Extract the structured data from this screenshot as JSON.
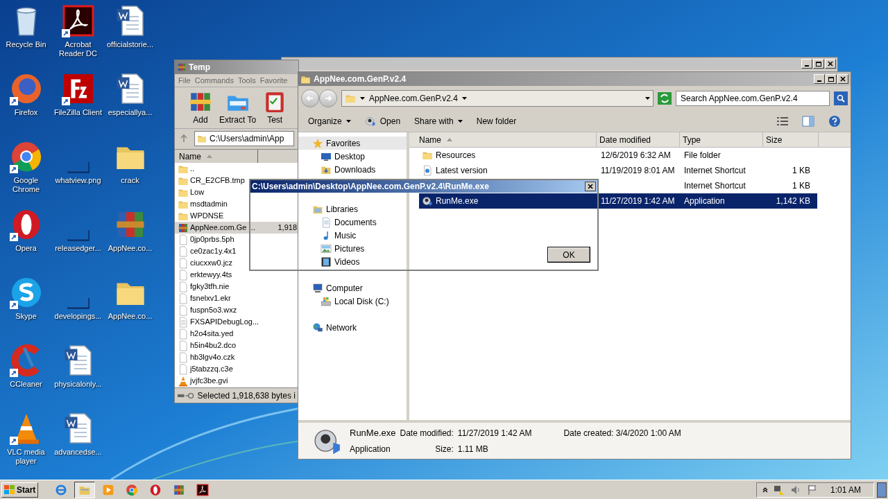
{
  "desktop_icons": [
    {
      "label": "Recycle Bin",
      "kind": "recycle",
      "shortcut": false
    },
    {
      "label": "Firefox",
      "kind": "firefox",
      "shortcut": true
    },
    {
      "label": "Google Chrome",
      "kind": "chrome",
      "shortcut": true
    },
    {
      "label": "Opera",
      "kind": "opera",
      "shortcut": true
    },
    {
      "label": "Skype",
      "kind": "skype",
      "shortcut": true
    },
    {
      "label": "CCleaner",
      "kind": "ccleaner",
      "shortcut": true
    },
    {
      "label": "VLC media player",
      "kind": "vlc",
      "shortcut": true
    },
    {
      "label": "Acrobat Reader DC",
      "kind": "acrobat",
      "shortcut": true
    },
    {
      "label": "FileZilla Client",
      "kind": "filezilla",
      "shortcut": true
    },
    {
      "label": "whatview.png",
      "kind": "blank",
      "shortcut": false
    },
    {
      "label": "releasedger...",
      "kind": "blank",
      "shortcut": false
    },
    {
      "label": "developings...",
      "kind": "blank",
      "shortcut": false
    },
    {
      "label": "physicalonly...",
      "kind": "word",
      "shortcut": false
    },
    {
      "label": "advancedse...",
      "kind": "word",
      "shortcut": false
    },
    {
      "label": "officialstorie...",
      "kind": "word",
      "shortcut": false
    },
    {
      "label": "especiallya...",
      "kind": "word",
      "shortcut": false
    },
    {
      "label": "crack",
      "kind": "folder",
      "shortcut": false
    },
    {
      "label": "AppNee.co...",
      "kind": "archive",
      "shortcut": false
    },
    {
      "label": "AppNee.co...",
      "kind": "folder",
      "shortcut": false
    }
  ],
  "winrar": {
    "title": "Temp",
    "menu": [
      "File",
      "Commands",
      "Tools",
      "Favorite"
    ],
    "tools": [
      {
        "label": "Add",
        "kind": "add"
      },
      {
        "label": "Extract To",
        "kind": "extract"
      },
      {
        "label": "Test",
        "kind": "test"
      }
    ],
    "path": "C:\\Users\\admin\\App",
    "columns": [
      "Name"
    ],
    "files": [
      {
        "name": "..",
        "kind": "folder",
        "selected": false
      },
      {
        "name": "CR_E2CFB.tmp",
        "kind": "folder",
        "selected": false
      },
      {
        "name": "Low",
        "kind": "folder",
        "selected": false
      },
      {
        "name": "msdtadmin",
        "kind": "folder",
        "selected": false
      },
      {
        "name": "WPDNSE",
        "kind": "folder",
        "selected": false
      },
      {
        "name": "AppNee.com.Ge …",
        "kind": "archive",
        "selected": true,
        "size": "1,918"
      },
      {
        "name": "0jp0prbs.5ph",
        "kind": "file",
        "selected": false
      },
      {
        "name": "ce0zac1y.4x1",
        "kind": "file",
        "selected": false
      },
      {
        "name": "ciucxxw0.jcz",
        "kind": "file",
        "selected": false
      },
      {
        "name": "erktewyy.4ts",
        "kind": "file",
        "selected": false
      },
      {
        "name": "fgky3tfh.nie",
        "kind": "file",
        "selected": false
      },
      {
        "name": "fsnelxv1.ekr",
        "kind": "file",
        "selected": false
      },
      {
        "name": "fuspn5o3.wxz",
        "kind": "file",
        "selected": false
      },
      {
        "name": "FXSAPIDebugLog...",
        "kind": "log",
        "selected": false
      },
      {
        "name": "h2o4sita.yed",
        "kind": "file",
        "selected": false
      },
      {
        "name": "h5in4bu2.dco",
        "kind": "file",
        "selected": false
      },
      {
        "name": "hb3lgv4o.czk",
        "kind": "file",
        "selected": false
      },
      {
        "name": "j5tabzzq.c3e",
        "kind": "file",
        "selected": false
      },
      {
        "name": "jvjfc3be.gvi",
        "kind": "vlc",
        "selected": false
      }
    ],
    "status": "Selected 1,918,638 bytes i"
  },
  "explorer": {
    "title": "AppNee.com.GenP.v2.4",
    "address": "AppNee.com.GenP.v2.4",
    "search": {
      "placeholder": "Search AppNee.com.GenP.v2.4"
    },
    "commands": [
      {
        "label": "Organize",
        "menu": true
      },
      {
        "label": "Open",
        "menu": false
      },
      {
        "label": "Share with",
        "menu": true
      },
      {
        "label": "New folder",
        "menu": false
      }
    ],
    "nav": [
      {
        "label": "Favorites",
        "kind": "star",
        "selected": true,
        "children": [
          {
            "label": "Desktop",
            "kind": "desktop",
            "selected": false
          },
          {
            "label": "Downloads",
            "kind": "downloads",
            "selected": false
          }
        ]
      },
      {
        "label": "Libraries",
        "kind": "libraries",
        "selected": false,
        "children": [
          {
            "label": "Documents",
            "kind": "documents",
            "selected": false
          },
          {
            "label": "Music",
            "kind": "music",
            "selected": false
          },
          {
            "label": "Pictures",
            "kind": "pictures",
            "selected": false
          },
          {
            "label": "Videos",
            "kind": "videos",
            "selected": false
          }
        ]
      },
      {
        "label": "Computer",
        "kind": "computer",
        "selected": false,
        "children": [
          {
            "label": "Local Disk (C:)",
            "kind": "disk",
            "selected": false
          }
        ]
      },
      {
        "label": "Network",
        "kind": "network",
        "selected": false
      }
    ],
    "columns": [
      "Name",
      "Date modified",
      "Type",
      "Size"
    ],
    "rows": [
      {
        "name": "Resources",
        "kind": "folder",
        "date": "12/6/2019 6:32 AM",
        "type": "File folder",
        "size": "",
        "selected": false
      },
      {
        "name": "Latest version",
        "kind": "link",
        "date": "11/19/2019 8:01 AM",
        "type": "Internet Shortcut",
        "size": "1 KB",
        "selected": false
      },
      {
        "type": "Internet Shortcut",
        "size": "1 KB",
        "selected": false
      },
      {
        "name": "RunMe.exe",
        "kind": "app",
        "date": "11/27/2019 1:42 AM",
        "type": "Application",
        "size": "1,142 KB",
        "selected": true
      }
    ],
    "details": {
      "name": "RunMe.exe",
      "type": "Application",
      "fields": [
        {
          "label": "Date modified:",
          "value": "11/27/2019 1:42 AM"
        },
        {
          "label": "Size:",
          "value": "1.11 MB"
        },
        {
          "label": "Date created:",
          "value": "3/4/2020 1:00 AM"
        }
      ]
    }
  },
  "dialog": {
    "title": "C:\\Users\\admin\\Desktop\\AppNee.com.GenP.v2.4\\RunMe.exe",
    "button": "OK"
  },
  "taskbar": {
    "start": "Start",
    "apps": [
      {
        "kind": "ie",
        "active": false
      },
      {
        "kind": "explorer",
        "active": true
      },
      {
        "kind": "media",
        "active": false
      },
      {
        "kind": "chrome",
        "active": false
      },
      {
        "kind": "opera",
        "active": false
      },
      {
        "kind": "winrar",
        "active": false
      },
      {
        "kind": "acrobat",
        "active": false
      }
    ],
    "time": "1:01 AM"
  }
}
